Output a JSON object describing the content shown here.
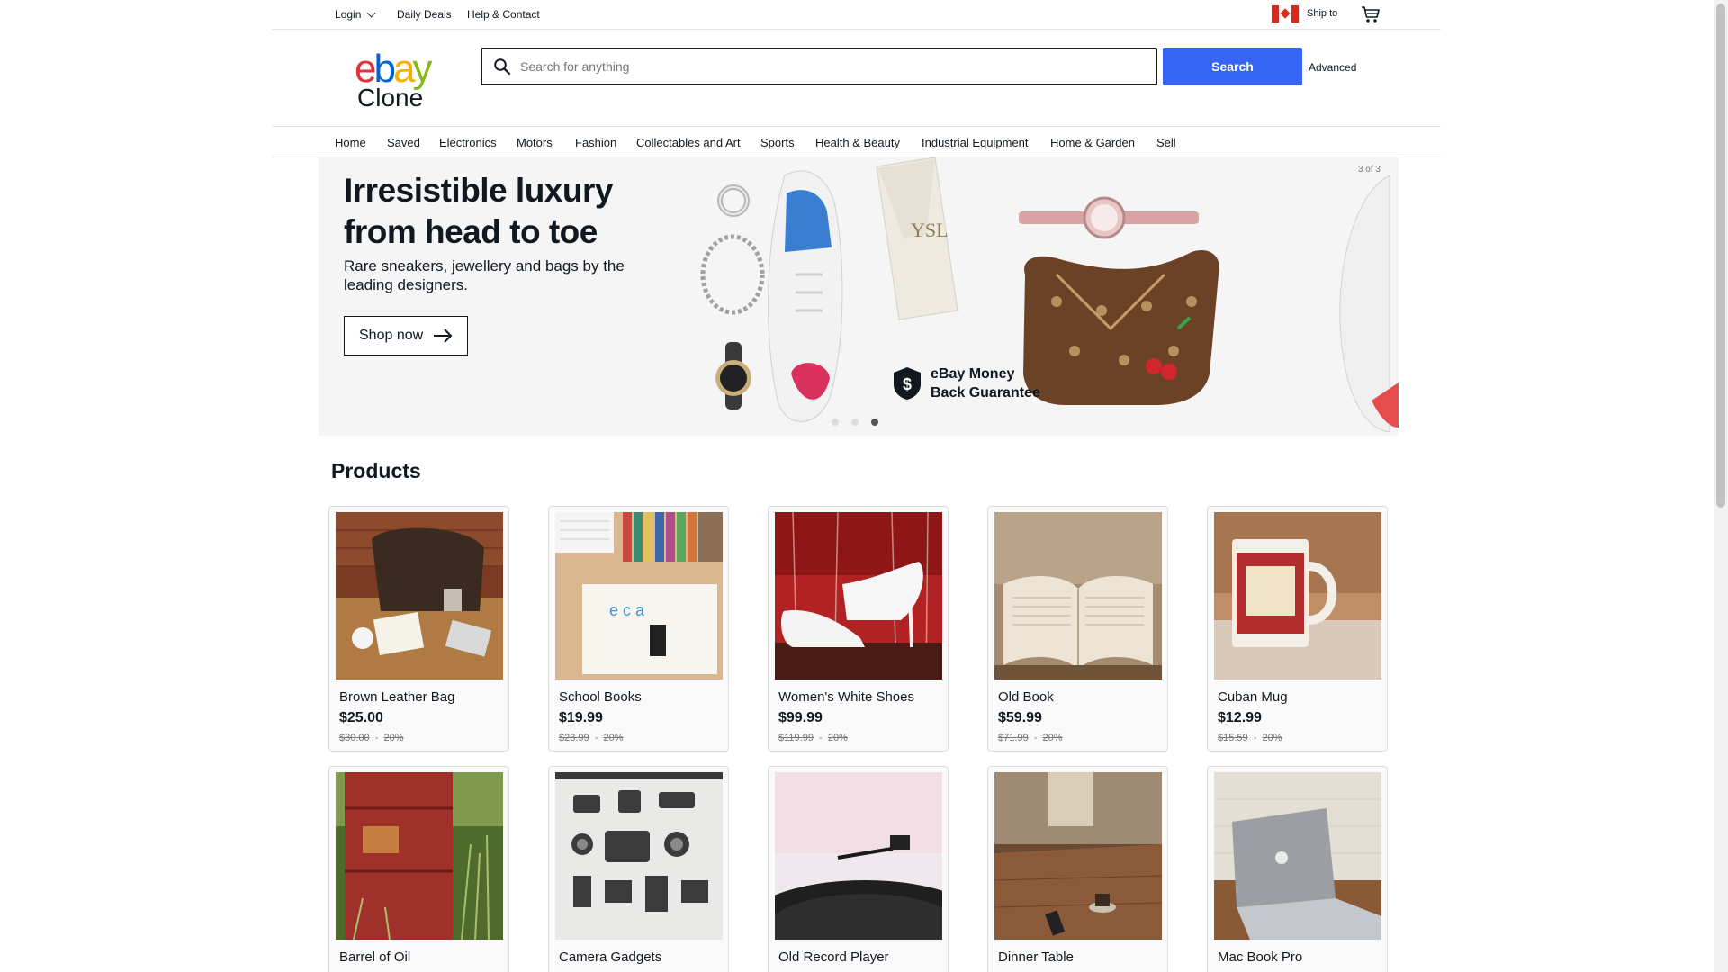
{
  "topbar": {
    "login": "Login",
    "daily_deals": "Daily Deals",
    "help": "Help & Contact",
    "ship_to": "Ship to"
  },
  "header": {
    "logo_top": "ebay",
    "logo_bottom": "Clone",
    "search_placeholder": "Search for anything",
    "search_button": "Search",
    "advanced": "Advanced"
  },
  "nav": {
    "items": [
      "Home",
      "Saved",
      "Electronics",
      "Motors",
      "Fashion",
      "Collectables and Art",
      "Sports",
      "Health & Beauty",
      "Industrial Equipment",
      "Home & Garden",
      "Sell"
    ]
  },
  "banner": {
    "title_line1": "Irresistible luxury",
    "title_line2": "from head to toe",
    "subtitle": "Rare sneakers, jewellery and bags by the leading designers.",
    "cta": "Shop now",
    "counter": "3 of 3",
    "guarantee_line1": "eBay Money",
    "guarantee_line2": "Back Guarantee",
    "active_slide": 3,
    "slide_count": 3
  },
  "products": {
    "title": "Products",
    "items": [
      {
        "name": "Brown Leather Bag",
        "price": "$25.00",
        "was": "$30.00",
        "discount": "20%"
      },
      {
        "name": "School Books",
        "price": "$19.99",
        "was": "$23.99",
        "discount": "20%"
      },
      {
        "name": "Women's White Shoes",
        "price": "$99.99",
        "was": "$119.99",
        "discount": "20%"
      },
      {
        "name": "Old Book",
        "price": "$59.99",
        "was": "$71.99",
        "discount": "20%"
      },
      {
        "name": "Cuban Mug",
        "price": "$12.99",
        "was": "$15.59",
        "discount": "20%"
      },
      {
        "name": "Barrel of Oil"
      },
      {
        "name": "Camera Gadgets"
      },
      {
        "name": "Old Record Player"
      },
      {
        "name": "Dinner Table"
      },
      {
        "name": "Mac Book Pro"
      }
    ]
  },
  "colors": {
    "search_button": "#3665f3",
    "logo_e": "#e53238",
    "logo_b": "#0064d2",
    "logo_a": "#f5af02",
    "logo_y": "#86b817"
  }
}
